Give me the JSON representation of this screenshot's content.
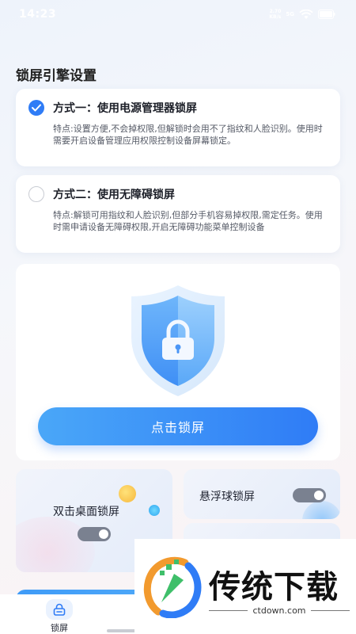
{
  "status_bar": {
    "time": "14:23",
    "net_speed_value": "2.70",
    "net_speed_unit": "KB/s",
    "signal": "5G"
  },
  "section_title": "锁屏引擎设置",
  "options": [
    {
      "title": "方式一：使用电源管理器锁屏",
      "selected": true,
      "description": "特点:设置方便,不会掉权限,但解锁时会用不了指纹和人脸识别。使用时需要开启设备管理应用权限控制设备屏幕锁定。"
    },
    {
      "title": "方式二：使用无障碍锁屏",
      "selected": false,
      "description": "特点:解锁可用指纹和人脸识别,但部分手机容易掉权限,需定任务。使用时需申请设备无障碍权限,开启无障碍功能菜单控制设备"
    }
  ],
  "main": {
    "lock_button_label": "点击锁屏"
  },
  "features": {
    "double_tap_label": "双击桌面锁屏",
    "float_ball_label": "悬浮球锁屏"
  },
  "bottom_nav": {
    "items": [
      {
        "label": "锁屏",
        "active": true
      }
    ]
  },
  "watermark": {
    "name": "传统下载",
    "url": "ctdown.com"
  },
  "colors": {
    "accent": "#2f7cf6",
    "toggle_off": "#7a8190"
  }
}
